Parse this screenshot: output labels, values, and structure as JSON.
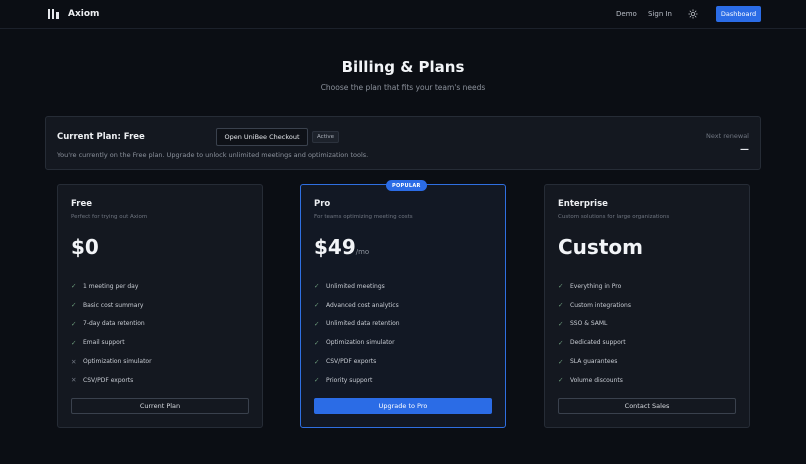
{
  "brand": {
    "name": "Axiom"
  },
  "nav": {
    "demo": "Demo",
    "sign_in": "Sign In",
    "theme_icon": "sun-icon",
    "dashboard": "Dashboard"
  },
  "colors": {
    "accent": "#2b6ce6",
    "background": "#0b0e14",
    "card": "#141820"
  },
  "page": {
    "title": "Billing & Plans",
    "subtitle": "Choose the plan that fits your team's needs"
  },
  "current_plan": {
    "title": "Current Plan: Free",
    "checkout_button": "Open UniBee Checkout",
    "status_badge": "Active",
    "description": "You're currently on the Free plan. Upgrade to unlock unlimited meetings and optimization tools.",
    "renewal_label": "Next renewal",
    "renewal_value": "—"
  },
  "plans": [
    {
      "name": "Free",
      "tagline": "Perfect for trying out Axiom",
      "price": "$0",
      "period": "",
      "features": [
        {
          "label": "1 meeting per day",
          "included": true
        },
        {
          "label": "Basic cost summary",
          "included": true
        },
        {
          "label": "7-day data retention",
          "included": true
        },
        {
          "label": "Email support",
          "included": true
        },
        {
          "label": "Optimization simulator",
          "included": false
        },
        {
          "label": "CSV/PDF exports",
          "included": false
        }
      ],
      "cta": "Current Plan"
    },
    {
      "name": "Pro",
      "badge": "POPULAR",
      "tagline": "For teams optimizing meeting costs",
      "price": "$49",
      "period": "/mo",
      "features": [
        {
          "label": "Unlimited meetings",
          "included": true
        },
        {
          "label": "Advanced cost analytics",
          "included": true
        },
        {
          "label": "Unlimited data retention",
          "included": true
        },
        {
          "label": "Optimization simulator",
          "included": true
        },
        {
          "label": "CSV/PDF exports",
          "included": true
        },
        {
          "label": "Priority support",
          "included": true
        }
      ],
      "cta": "Upgrade to Pro"
    },
    {
      "name": "Enterprise",
      "tagline": "Custom solutions for large organizations",
      "price": "Custom",
      "period": "",
      "features": [
        {
          "label": "Everything in Pro",
          "included": true
        },
        {
          "label": "Custom integrations",
          "included": true
        },
        {
          "label": "SSO & SAML",
          "included": true
        },
        {
          "label": "Dedicated support",
          "included": true
        },
        {
          "label": "SLA guarantees",
          "included": true
        },
        {
          "label": "Volume discounts",
          "included": true
        }
      ],
      "cta": "Contact Sales"
    }
  ]
}
